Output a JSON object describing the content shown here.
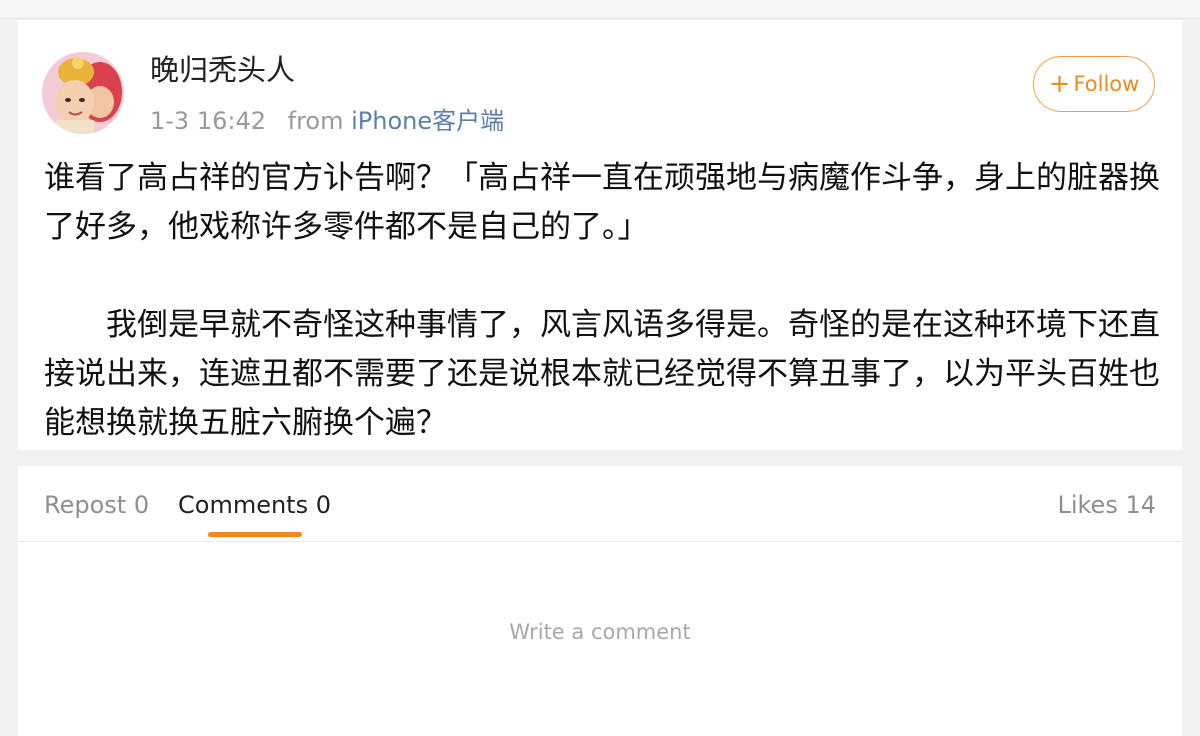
{
  "post": {
    "username": "晚归秃头人",
    "time": "1-3 16:42",
    "from_label": "from",
    "client": "iPhone客户端",
    "follow_label": "Follow",
    "paragraphs": [
      "谁看了高占祥的官方讣告啊？「高占祥一直在顽强地与病魔作斗争，身上的脏器换了好多，他戏称许多零件都不是自己的了。」",
      "我倒是早就不奇怪这种事情了，风言风语多得是。奇怪的是在这种环境下还直接说出来，连遮丑都不需要了还是说根本就已经觉得不算丑事了，以为平头百姓也能想换就换五脏六腑换个遍？"
    ]
  },
  "tabs": {
    "repost": "Repost 0",
    "comments": "Comments 0",
    "likes": "Likes 14"
  },
  "comment_box": {
    "placeholder": "Write a comment"
  },
  "colors": {
    "accent": "#f08a1e",
    "link": "#5b7fb0"
  },
  "icons": {
    "follow": "plus-icon",
    "avatar": "user-avatar"
  }
}
